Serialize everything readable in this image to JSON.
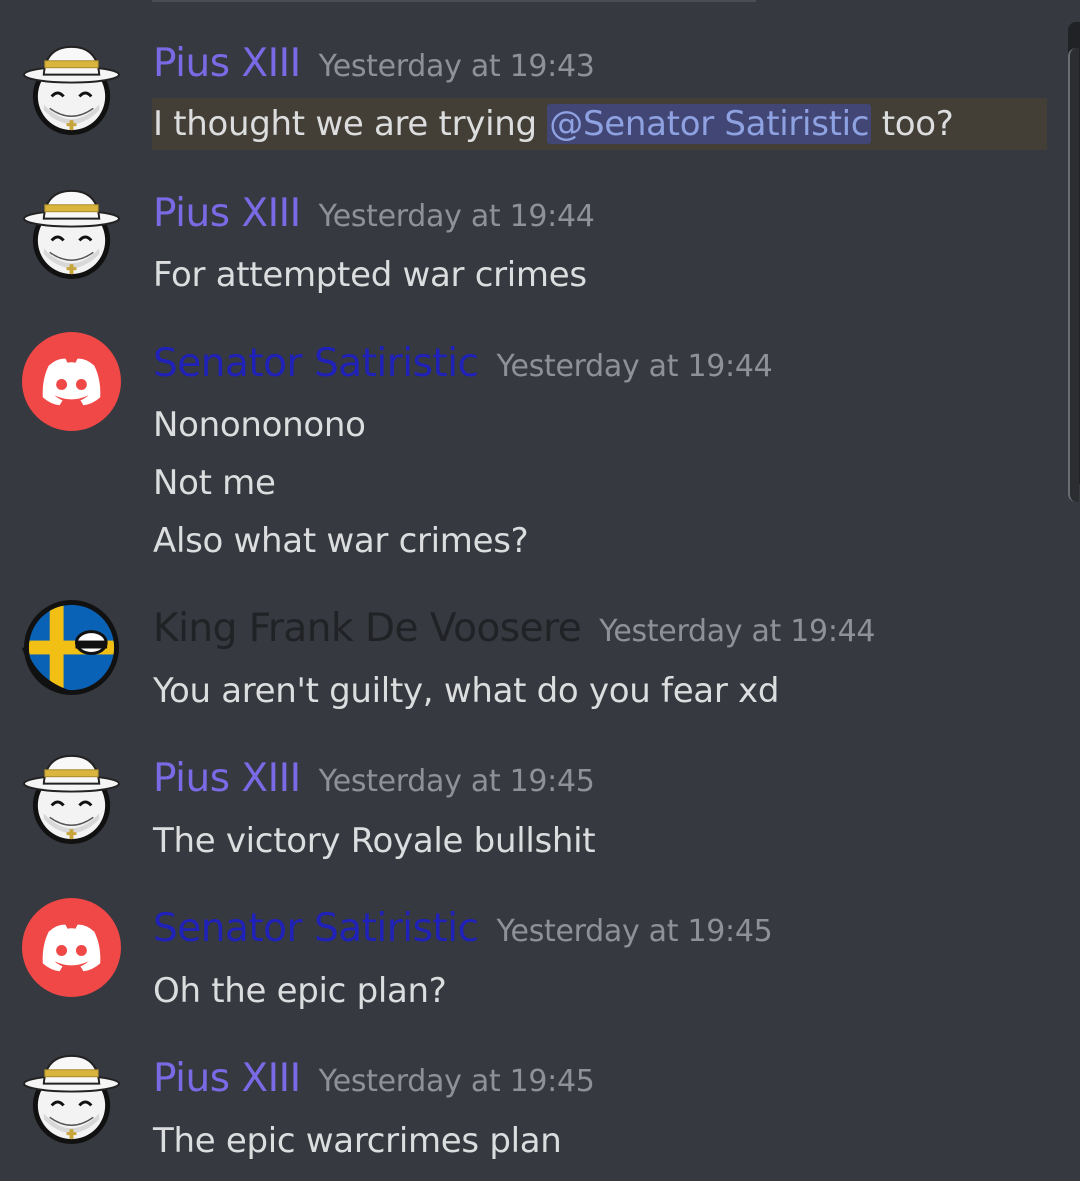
{
  "colors": {
    "pius_name": "#7b69e5",
    "senator_name": "#1f21b8",
    "frank_name": "#202225",
    "timestamp": "#8e9297",
    "message_text": "#dcddde",
    "mention_bg": "#414675",
    "mention_text": "#8ea1e1",
    "highlight_bg": "#443f36",
    "discord_red": "#f04747"
  },
  "messages": [
    {
      "author": "Pius XIII",
      "timestamp": "Yesterday at 19:43",
      "avatar": "pius-avatar",
      "text_before": "I thought we are trying ",
      "mention": "@Senator Satiristic",
      "text_after": " too?"
    },
    {
      "author": "Pius XIII",
      "timestamp": "Yesterday at 19:44",
      "avatar": "pius-avatar",
      "lines": [
        "For attempted war crimes"
      ]
    },
    {
      "author": "Senator Satiristic",
      "timestamp": "Yesterday at 19:44",
      "avatar": "discord-default-avatar",
      "lines": [
        "Nonononono",
        "Not me",
        "Also what war crimes?"
      ]
    },
    {
      "author": "King Frank De Voosere",
      "timestamp": "Yesterday at 19:44",
      "avatar": "sweden-ball-avatar",
      "lines": [
        "You aren't guilty, what do you fear xd"
      ]
    },
    {
      "author": "Pius XIII",
      "timestamp": "Yesterday at 19:45",
      "avatar": "pius-avatar",
      "lines": [
        "The victory Royale bullshit"
      ]
    },
    {
      "author": "Senator Satiristic",
      "timestamp": "Yesterday at 19:45",
      "avatar": "discord-default-avatar",
      "lines": [
        "Oh the epic plan?"
      ]
    },
    {
      "author": "Pius XIII",
      "timestamp": "Yesterday at 19:45",
      "avatar": "pius-avatar",
      "lines": [
        "The epic warcrimes plan"
      ]
    }
  ]
}
